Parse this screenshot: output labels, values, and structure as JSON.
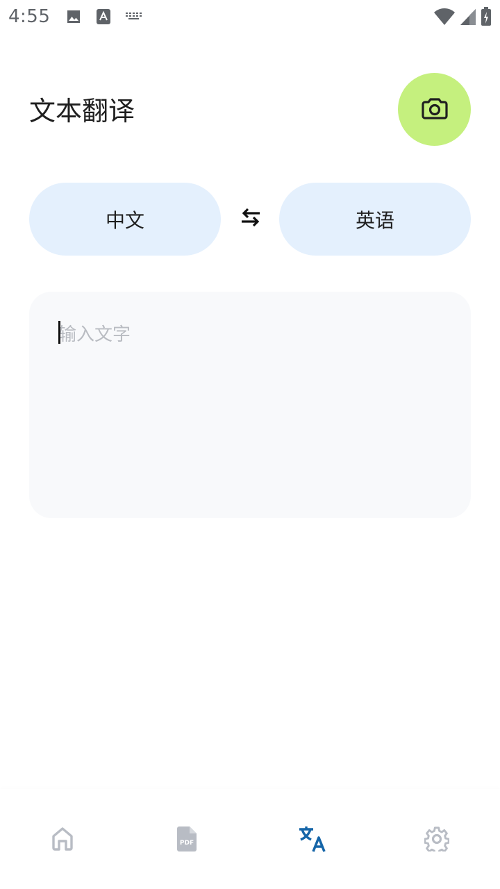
{
  "status_bar": {
    "time": "4:55"
  },
  "header": {
    "title": "文本翻译"
  },
  "language": {
    "source": "中文",
    "target": "英语"
  },
  "input": {
    "placeholder": "输入文字",
    "value": ""
  },
  "colors": {
    "fab": "#c5f07e",
    "pill": "#e4f0fd",
    "input_bg": "#f8f9fb",
    "nav_active": "#1565a8",
    "nav_inactive": "#b8bcc4"
  },
  "bottom_nav": {
    "items": [
      {
        "icon": "home-icon",
        "active": false
      },
      {
        "icon": "pdf-icon",
        "active": false
      },
      {
        "icon": "translate-icon",
        "active": true
      },
      {
        "icon": "gear-icon",
        "active": false
      }
    ]
  }
}
